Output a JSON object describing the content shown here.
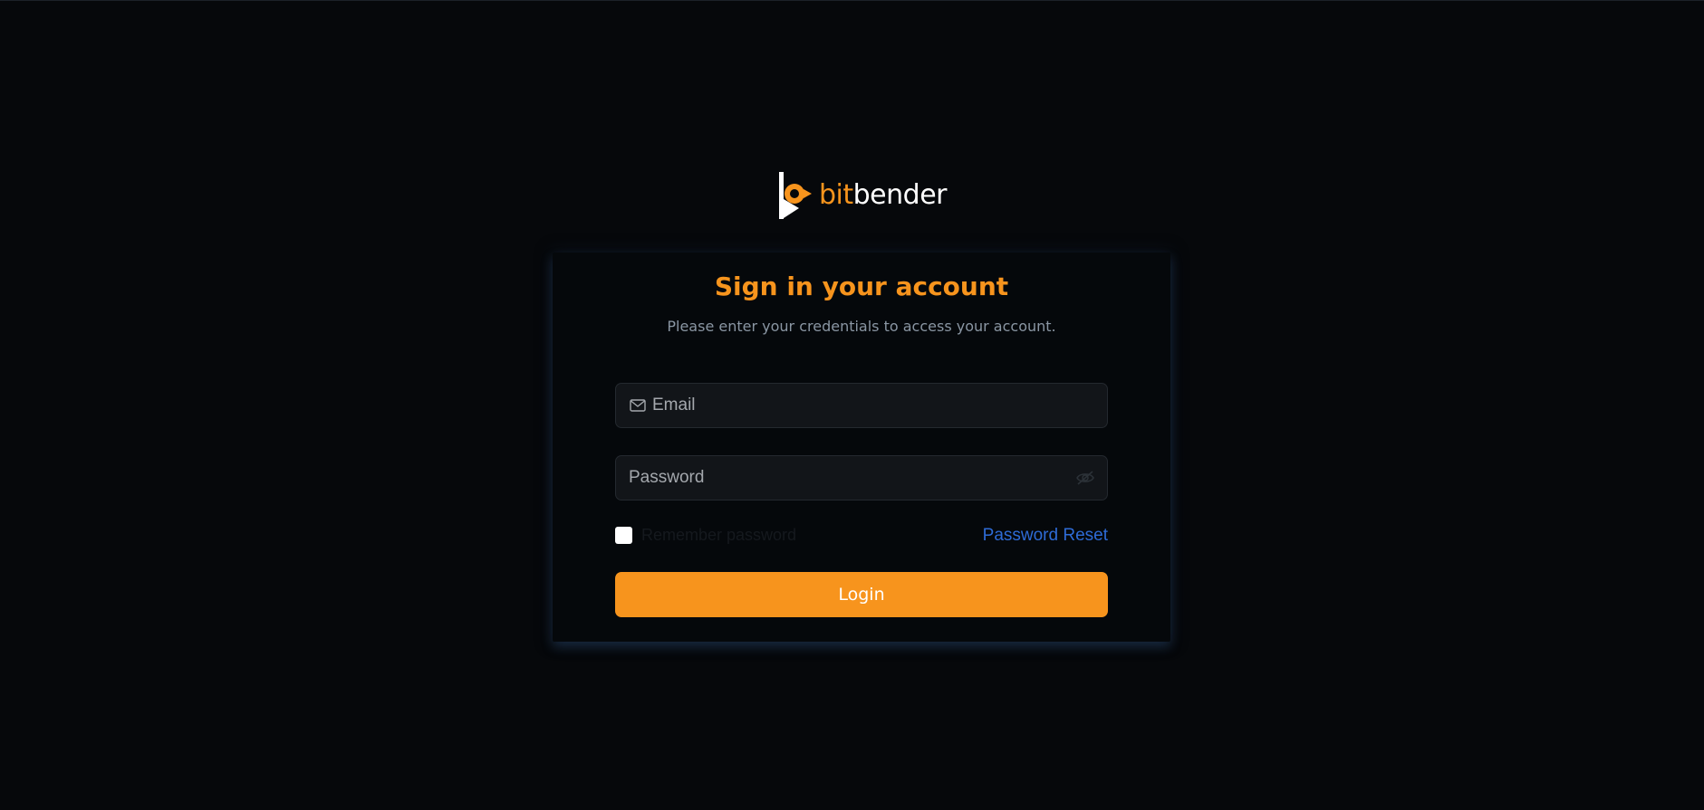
{
  "brand": {
    "name_part1": "bit",
    "name_part2": "bender",
    "accent_color": "#f7941d",
    "logo_icon": "play-b-logo-icon"
  },
  "login": {
    "title": "Sign in your account",
    "subtitle": "Please enter your credentials to access your account.",
    "email": {
      "placeholder": "Email",
      "value": "",
      "icon": "envelope-icon"
    },
    "password": {
      "placeholder": "Password",
      "value": "",
      "icon": "eye-off-icon"
    },
    "remember_label": "Remember password",
    "remember_checked": false,
    "reset_label": "Password Reset",
    "submit_label": "Login"
  }
}
